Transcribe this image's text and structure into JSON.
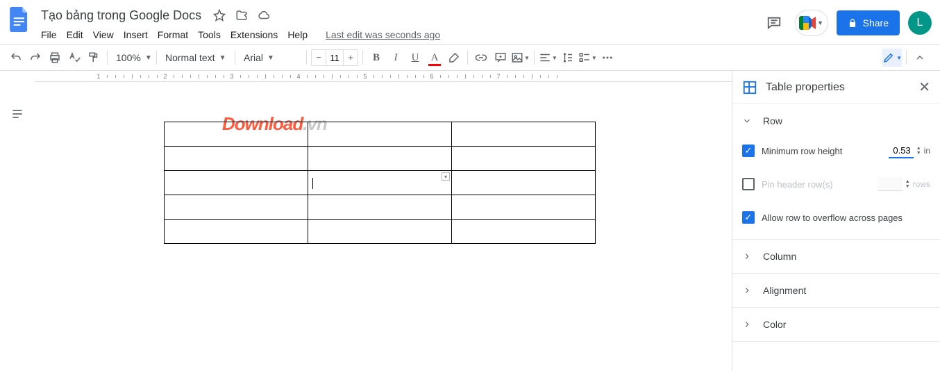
{
  "header": {
    "doc_title": "Tạo bảng trong Google Docs",
    "menus": [
      "File",
      "Edit",
      "View",
      "Insert",
      "Format",
      "Tools",
      "Extensions",
      "Help"
    ],
    "last_edit": "Last edit was seconds ago",
    "share_label": "Share",
    "avatar_letter": "L"
  },
  "toolbar": {
    "zoom": "100%",
    "style": "Normal text",
    "font": "Arial",
    "font_size": "11"
  },
  "ruler": {
    "numbers": [
      "1",
      "2",
      "3",
      "4",
      "5",
      "6",
      "7"
    ]
  },
  "watermark": {
    "part1": "Download",
    "part2": ".vn"
  },
  "sidepanel": {
    "title": "Table properties",
    "sections": {
      "row": {
        "label": "Row",
        "min_row_height": {
          "label": "Minimum row height",
          "value": "0.53",
          "unit": "in",
          "checked": true
        },
        "pin_header": {
          "label": "Pin header row(s)",
          "unit": "rows",
          "checked": false
        },
        "overflow": {
          "label": "Allow row to overflow across pages",
          "checked": true
        }
      },
      "column": {
        "label": "Column"
      },
      "alignment": {
        "label": "Alignment"
      },
      "color": {
        "label": "Color"
      }
    }
  }
}
